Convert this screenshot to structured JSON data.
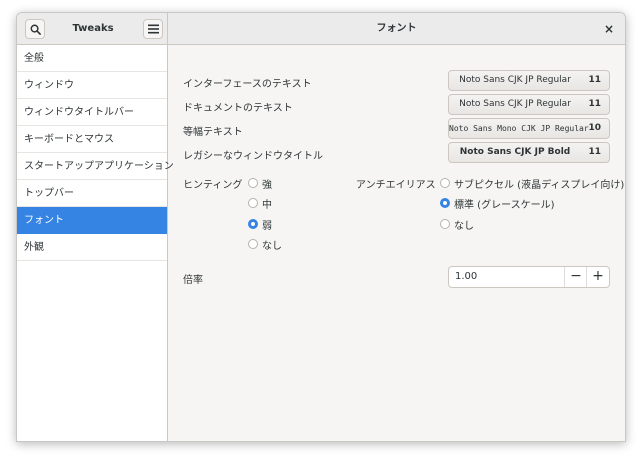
{
  "header": {
    "app_title": "Tweaks",
    "page_title": "フォント",
    "search_icon": "search-icon",
    "menu_icon": "hamburger-menu-icon",
    "close_glyph": "×"
  },
  "sidebar": {
    "items": [
      {
        "label": "全般"
      },
      {
        "label": "ウィンドウ"
      },
      {
        "label": "ウィンドウタイトルバー"
      },
      {
        "label": "キーボードとマウス"
      },
      {
        "label": "スタートアップアプリケーション"
      },
      {
        "label": "トップバー"
      },
      {
        "label": "フォント",
        "active": true
      },
      {
        "label": "外観"
      }
    ]
  },
  "fonts": {
    "interface": {
      "label": "インターフェースのテキスト",
      "font": "Noto Sans CJK JP Regular",
      "size": "11"
    },
    "document": {
      "label": "ドキュメントのテキスト",
      "font": "Noto Sans CJK JP Regular",
      "size": "11"
    },
    "monospace": {
      "label": "等幅テキスト",
      "font": "Noto Sans Mono CJK JP Regular",
      "size": "10"
    },
    "legacy": {
      "label": "レガシーなウィンドウタイトル",
      "font": "Noto Sans CJK JP Bold",
      "size": "11"
    }
  },
  "hinting": {
    "label": "ヒンティング",
    "options": [
      "強",
      "中",
      "弱",
      "なし"
    ],
    "selected": "弱"
  },
  "antialiasing": {
    "label": "アンチエイリアス",
    "options": [
      "サブピクセル (液晶ディスプレイ向け)",
      "標準 (グレースケール)",
      "なし"
    ],
    "selected": "標準 (グレースケール)"
  },
  "scaling": {
    "label": "倍率",
    "value": "1.00",
    "minus": "−",
    "plus": "+"
  },
  "colors": {
    "accent": "#3584e4",
    "headerbar": "#ebebeb",
    "content_bg": "#f6f5f4"
  }
}
